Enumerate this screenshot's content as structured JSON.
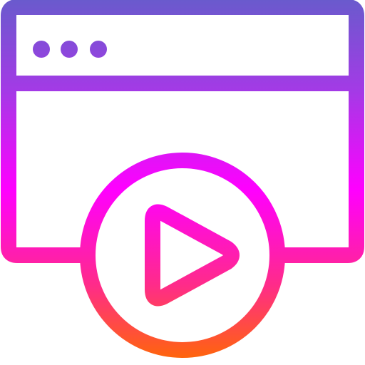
{
  "icon": {
    "name": "browser-video-play-icon",
    "gradient": {
      "top": "#6a5acd",
      "upper": "#a43ae6",
      "middle": "#ff00ff",
      "lower": "#ff2b8a",
      "bottom": "#ff6a00"
    },
    "window_dots": 3
  }
}
